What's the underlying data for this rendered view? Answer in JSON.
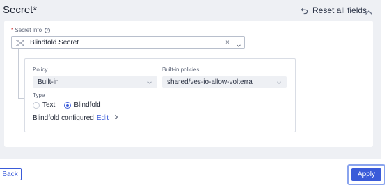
{
  "section": {
    "title": "Secret",
    "required_mark": "*"
  },
  "header_actions": {
    "reset_label": "Reset all fields"
  },
  "secret_info": {
    "label": "Secret Info",
    "required_mark": "*",
    "help_glyph": "?",
    "selected_value": "Blindfold Secret",
    "clear_glyph": "×"
  },
  "policy": {
    "policy_label": "Policy",
    "policy_value": "Built-in",
    "builtin_label": "Built-in policies",
    "builtin_value": "shared/ves-io-allow-volterra"
  },
  "type": {
    "label": "Type",
    "options": [
      "Text",
      "Blindfold"
    ],
    "selected": "Blindfold"
  },
  "configured": {
    "text": "Blindfold configured",
    "edit_label": "Edit",
    "chevron": "›"
  },
  "footer": {
    "back_label": "Back",
    "apply_label": "Apply"
  },
  "colors": {
    "accent": "#3a5bd9",
    "panel_bg": "#eef0f4",
    "focus_ring": "#8aa4ee"
  },
  "icons": [
    "undo-arrow-icon",
    "chevron-up-icon",
    "help-icon",
    "blindfold-secret-icon",
    "clear-icon",
    "chevron-down-icon",
    "chevron-right-icon"
  ]
}
